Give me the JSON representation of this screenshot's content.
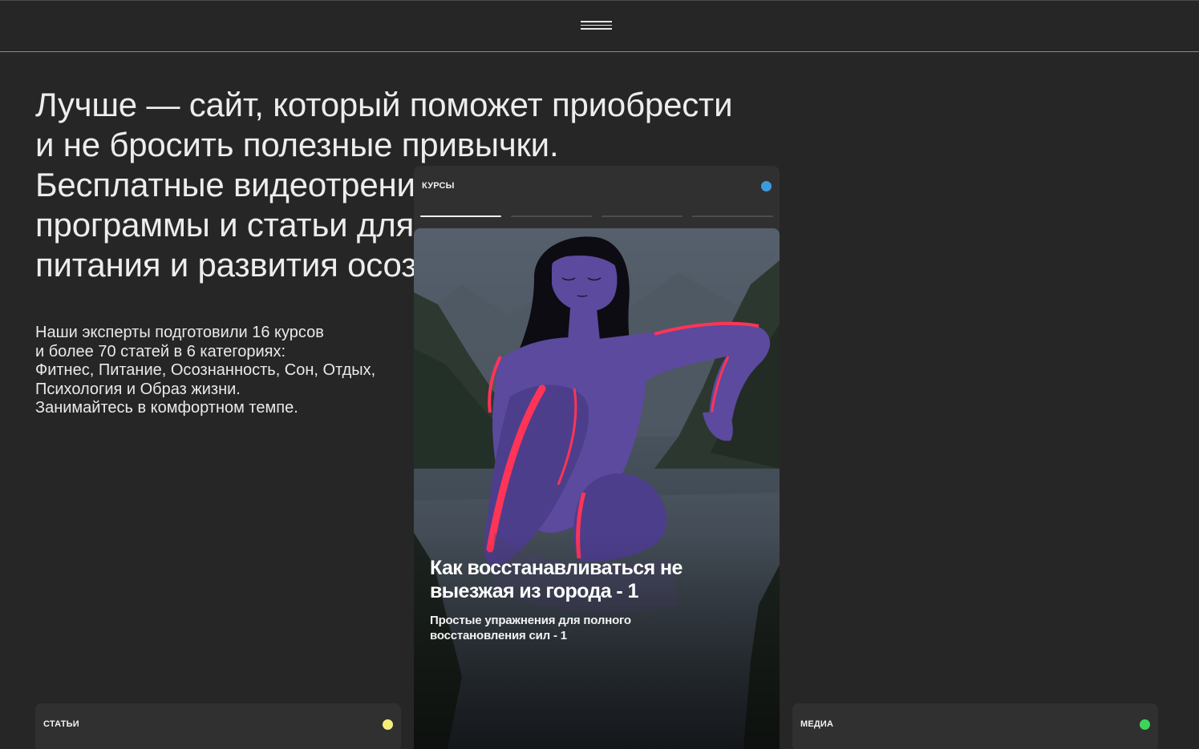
{
  "header": {
    "menu_icon": "hamburger-menu-icon"
  },
  "hero": {
    "title": "Лучше — сайт, который поможет приобрести\nи не бросить полезные привычки.\nБесплатные видеотренировки, медитации,\nпрограммы и статьи для фитнеса, сна,\nпитания и развития осознанности.",
    "description": "Наши эксперты подготовили 16 курсов\nи более 70 статей в 6 категориях:\nФитнес, Питание, Осознанность, Сон, Отдых,\nПсихология и Образ жизни.\nЗанимайтесь в комфортном темпе."
  },
  "cards": {
    "articles": {
      "label": "СТАТЬИ",
      "dot_color": "#f4ef7a"
    },
    "courses": {
      "label": "КУРСЫ",
      "dot_color": "#3e9bdb",
      "progress": [
        1,
        0,
        0,
        0
      ],
      "slide": {
        "title": "Как восстанавливаться не\nвыезжая из города - 1",
        "subtitle": "Простые упражнения для полного\nвосстановления сил - 1"
      }
    },
    "media": {
      "label": "МЕДИА",
      "dot_color": "#3bd55a"
    }
  },
  "colors": {
    "background": "#262626",
    "card": "#303030",
    "illustration_figure": "#5b4a9e",
    "illustration_accent": "#ff3457"
  }
}
